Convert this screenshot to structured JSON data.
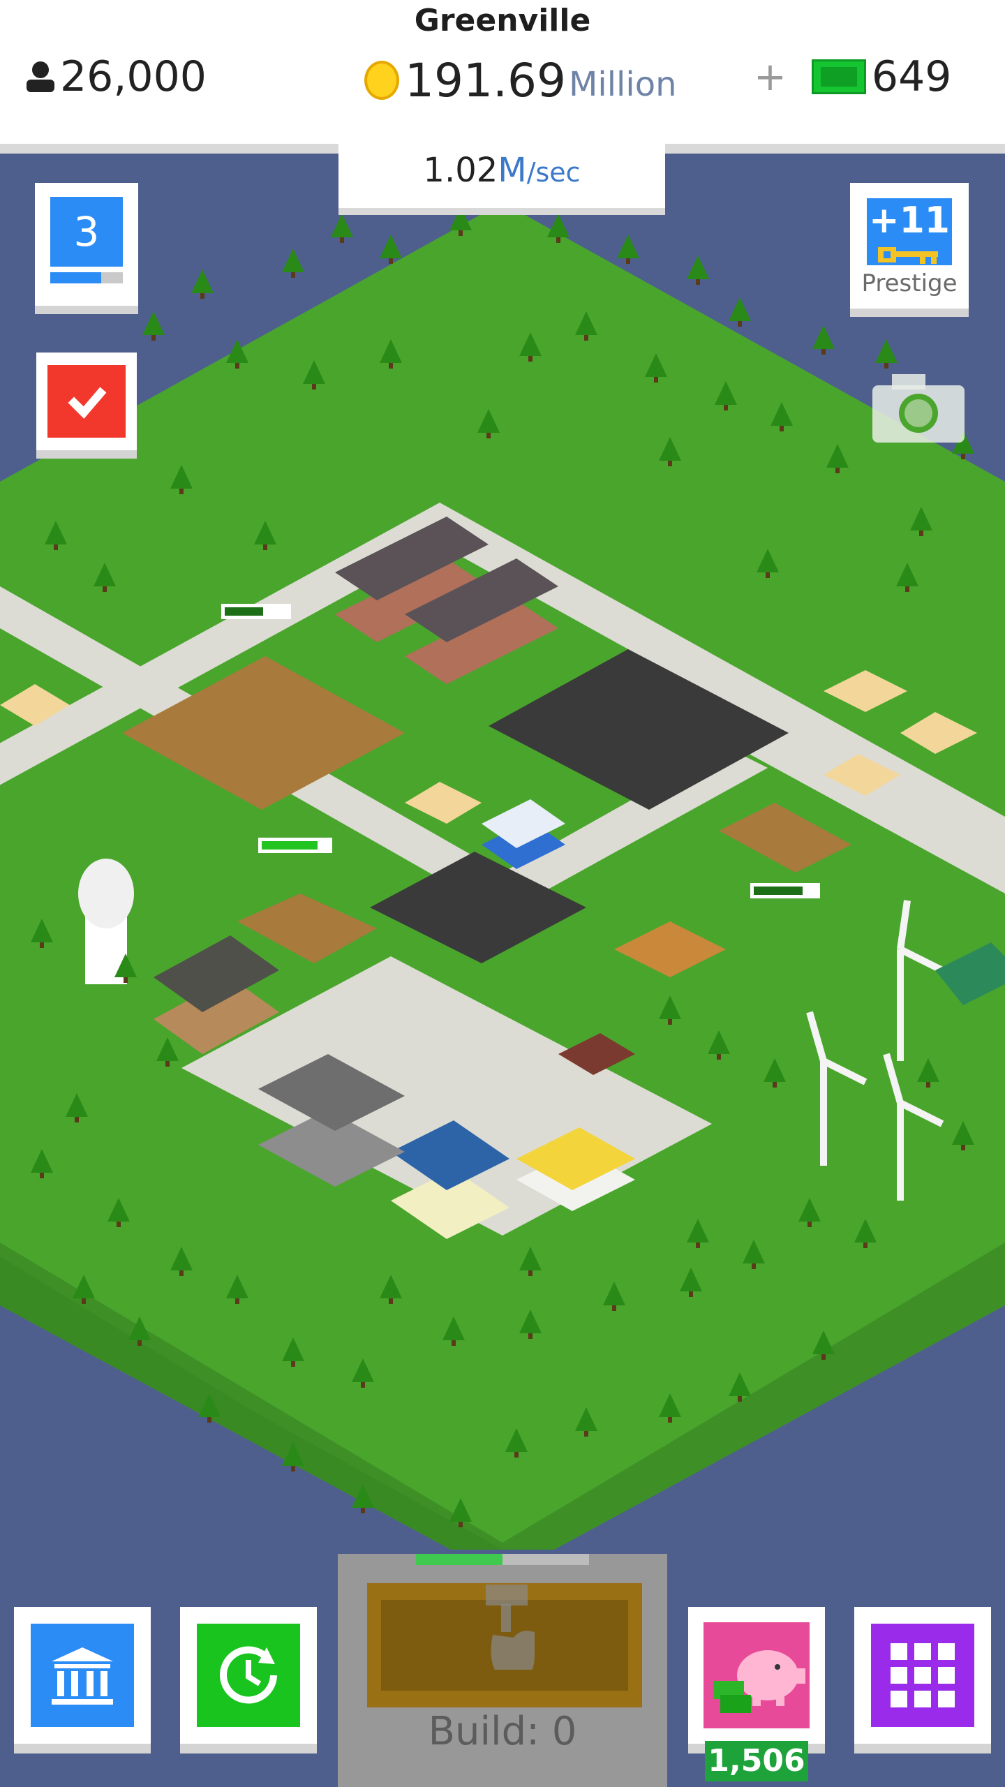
{
  "header": {
    "city_name": "Greenville",
    "population": "26,000",
    "money_value": "191.69",
    "money_unit": "Million",
    "cash_plus": "+",
    "cash": "649",
    "rate_value": "1.02",
    "rate_unit": "M",
    "rate_suffix": "/sec"
  },
  "left_panel": {
    "level": "3",
    "level_progress": 0.7,
    "tasks_icon": "checkmark-icon"
  },
  "right_panel": {
    "prestige_count": "+11",
    "prestige_label": "Prestige",
    "camera_icon": "camera-icon"
  },
  "bottom_bar": {
    "bank_icon": "bank-icon",
    "boost_icon": "clock-refresh-icon",
    "build_label": "Build: 0",
    "build_progress": 0.5,
    "piggy_bank_count": "1,506",
    "menu_icon": "grid-icon"
  },
  "colors": {
    "blue": "#2b8cf5",
    "red": "#f2382c",
    "green": "#19c41f",
    "pink": "#e74a98",
    "purple": "#9b2bea",
    "water": "#4e5f8e",
    "grass": "#4aa52d"
  }
}
